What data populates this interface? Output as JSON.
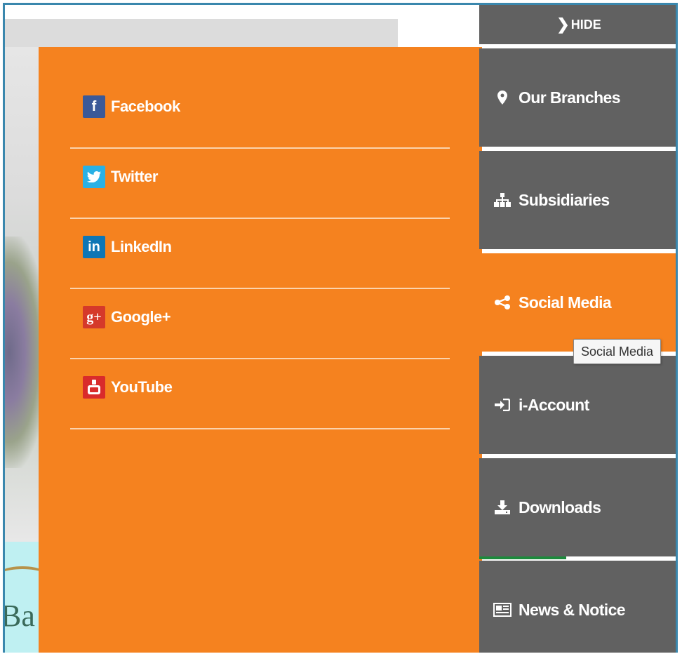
{
  "hide_label": "HIDE",
  "social": [
    {
      "label": "Facebook",
      "icon": "facebook-icon",
      "glyph": "f"
    },
    {
      "label": "Twitter",
      "icon": "twitter-icon",
      "glyph": "t"
    },
    {
      "label": "LinkedIn",
      "icon": "linkedin-icon",
      "glyph": "in"
    },
    {
      "label": "Google+",
      "icon": "google-plus-icon",
      "glyph": "g+"
    },
    {
      "label": "YouTube",
      "icon": "youtube-icon",
      "glyph": "You Tube"
    }
  ],
  "menu": [
    {
      "label": "Our Branches",
      "icon": "map-marker-icon"
    },
    {
      "label": "Subsidiaries",
      "icon": "sitemap-icon"
    },
    {
      "label": "Social Media",
      "icon": "share-icon",
      "active": true
    },
    {
      "label": "i-Account",
      "icon": "sign-in-icon"
    },
    {
      "label": "Downloads",
      "icon": "download-icon"
    },
    {
      "label": "News & Notice",
      "icon": "newspaper-icon"
    }
  ],
  "tooltip": "Social Media",
  "background_text": "Ba",
  "colors": {
    "orange": "#f5821f",
    "grey": "#616161",
    "green": "#1c8a3c"
  }
}
